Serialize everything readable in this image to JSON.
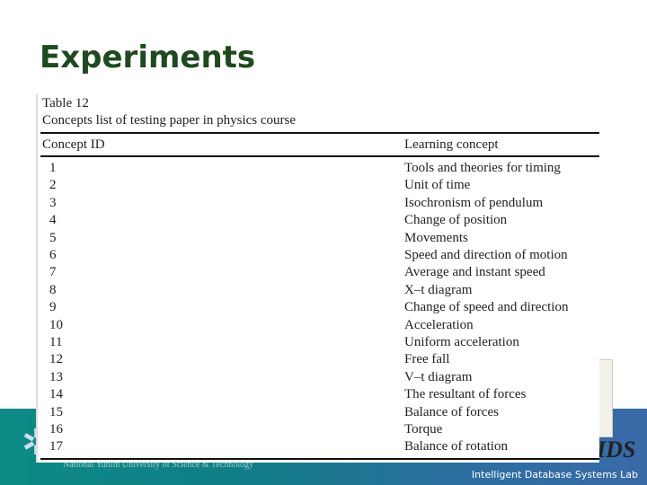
{
  "title": "Experiments",
  "table": {
    "label": "Table 12",
    "caption": "Concepts list of testing paper in physics course",
    "headers": [
      "Concept ID",
      "Learning concept"
    ],
    "rows": [
      [
        "1",
        "Tools and theories for timing"
      ],
      [
        "2",
        "Unit of time"
      ],
      [
        "3",
        "Isochronism of pendulum"
      ],
      [
        "4",
        "Change of position"
      ],
      [
        "5",
        "Movements"
      ],
      [
        "6",
        "Speed and direction of motion"
      ],
      [
        "7",
        "Average and instant speed"
      ],
      [
        "8",
        "X–t diagram"
      ],
      [
        "9",
        "Change of speed and direction"
      ],
      [
        "10",
        "Acceleration"
      ],
      [
        "11",
        "Uniform acceleration"
      ],
      [
        "12",
        "Free fall"
      ],
      [
        "13",
        "V–t diagram"
      ],
      [
        "14",
        "The resultant of forces"
      ],
      [
        "15",
        "Balance of forces"
      ],
      [
        "16",
        "Torque"
      ],
      [
        "17",
        "Balance of rotation"
      ]
    ]
  },
  "footer": {
    "university": "National Yunlin University of Science & Technology",
    "lab": "Intelligent Database Systems Lab",
    "ids_logo": "IDS"
  }
}
